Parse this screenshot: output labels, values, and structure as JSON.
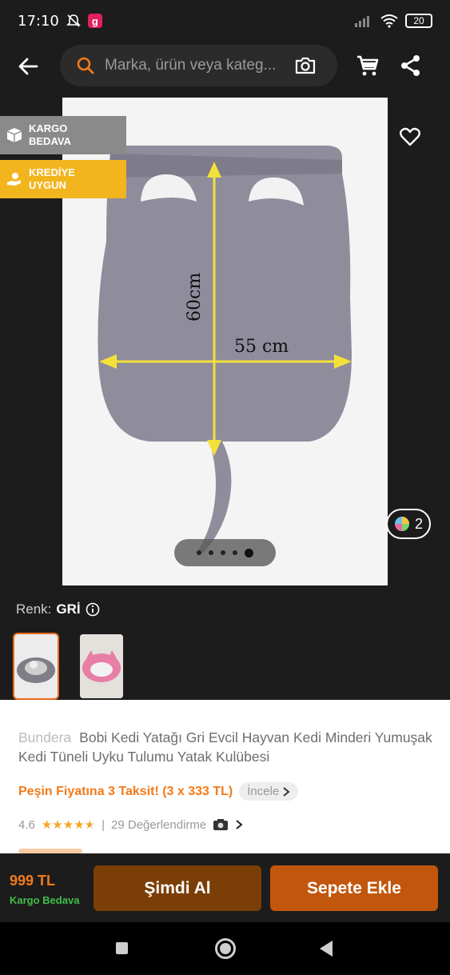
{
  "status": {
    "time": "17:10",
    "app_badge": "g",
    "battery": "20"
  },
  "search": {
    "placeholder": "Marka, ürün veya kateg..."
  },
  "badges": {
    "cargo": [
      "KARGO",
      "BEDAVA"
    ],
    "credit": [
      "KREDİYE",
      "UYGUN"
    ]
  },
  "product_image": {
    "height_label": "60cm",
    "width_label": "55 cm"
  },
  "gallery": {
    "variant_count": "2",
    "dot_count": 5,
    "active_dot": 5
  },
  "color": {
    "label": "Renk:",
    "value": "GRİ"
  },
  "product": {
    "brand": "Bundera",
    "title": "Bobi Kedi Yatağı Gri Evcil Hayvan Kedi Minderi Yumuşak Kedi Tüneli Uyku Tulumu Yatak Kulübesi",
    "installment_text": "Peşin Fiyatına 3 Taksit! (3 x 333 TL)",
    "installment_link": "İncele",
    "rating": "4.6",
    "rating_stars": 4.6,
    "reviews": "29 Değerlendirme"
  },
  "footer": {
    "price": "999 TL",
    "shipping": "Kargo Bedava",
    "buy_now": "Şimdi Al",
    "add_to_cart": "Sepete Ekle"
  },
  "colors": {
    "accent": "#f27a1a",
    "credit_badge": "#f3b51d",
    "cargo_badge": "#8a8a8a",
    "green": "#3fbf4a"
  }
}
